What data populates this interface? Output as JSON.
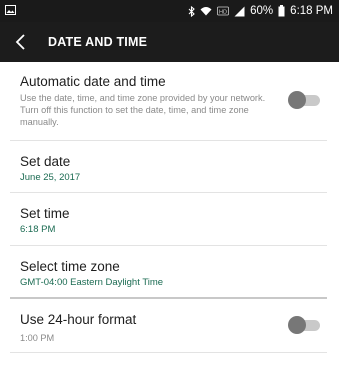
{
  "status_bar": {
    "icons": [
      "gallery-icon",
      "bluetooth-icon",
      "wifi-icon",
      "hd-voice-icon",
      "signal-icon",
      "battery-icon"
    ],
    "hd_label": "HD",
    "battery": "60%",
    "time": "6:18 PM"
  },
  "app_bar": {
    "title": "DATE AND TIME",
    "back_icon": "chevron-left-icon"
  },
  "settings": {
    "auto_date": {
      "title": "Automatic date and time",
      "description": "Use the date, time, and time zone provided by your network. Turn off this function to set the date, time, and time zone manually.",
      "enabled": false
    },
    "set_date": {
      "title": "Set date",
      "value": "June 25, 2017"
    },
    "set_time": {
      "title": "Set time",
      "value": "6:18 PM"
    },
    "time_zone": {
      "title": "Select time zone",
      "value": "GMT-04:00 Eastern Daylight Time"
    },
    "format_24": {
      "title": "Use 24-hour format",
      "value": "1:00 PM",
      "enabled": false
    }
  },
  "colors": {
    "status_bar_bg": "#1a1a1a",
    "app_bar_bg": "#1c1c1c",
    "accent_green": "#1b6b52",
    "toggle_off_thumb": "#777777",
    "toggle_off_track": "#c9c9c9"
  }
}
